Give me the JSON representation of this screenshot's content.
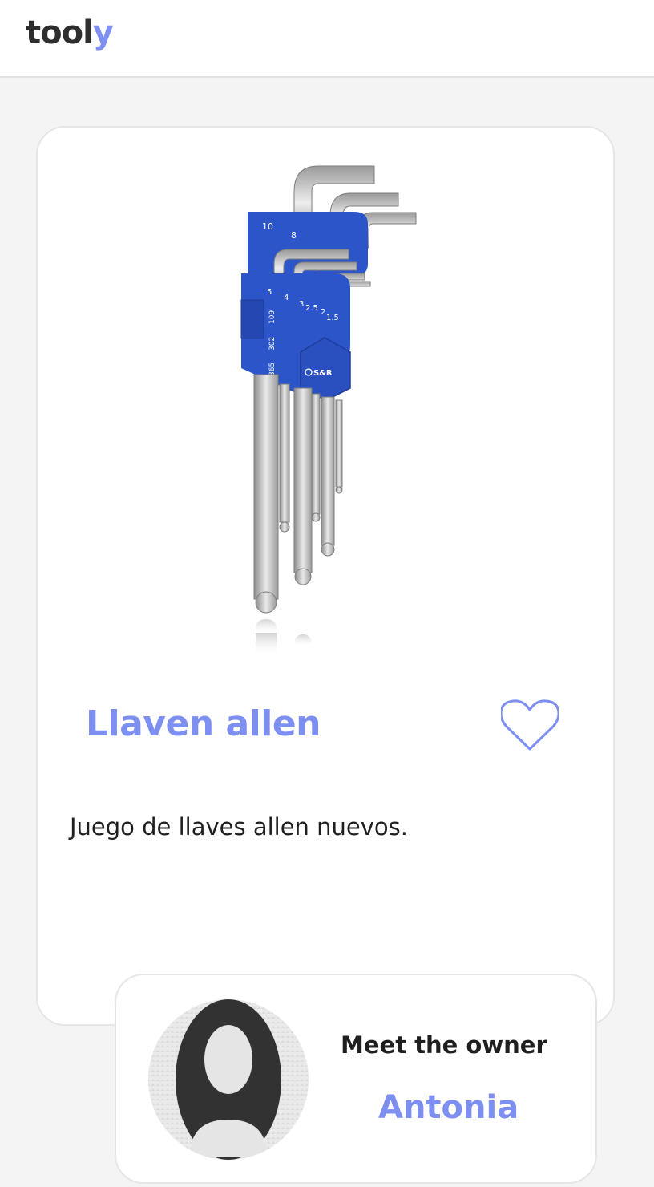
{
  "app": {
    "logo_main": "tool",
    "logo_accent": "y"
  },
  "product": {
    "title": "Llaven allen",
    "description": "Juego de llaves allen nuevos.",
    "image_alt": "Hex key set",
    "image_texts": {
      "sizes_top": [
        "10",
        "8"
      ],
      "sizes_bottom": [
        "5",
        "4",
        "3",
        "2.5",
        "2",
        "1.5"
      ],
      "codes": [
        "109",
        "302",
        "365"
      ],
      "brand": "S&R"
    },
    "favorite_icon": "heart-outline-icon"
  },
  "owner": {
    "label": "Meet the owner",
    "name": "Antonia",
    "avatar_icon": "user-avatar-icon"
  },
  "colors": {
    "accent": "#7d8ff0",
    "text": "#1f1f1f",
    "background": "#f4f4f4",
    "holder_blue": "#2b55c8"
  }
}
